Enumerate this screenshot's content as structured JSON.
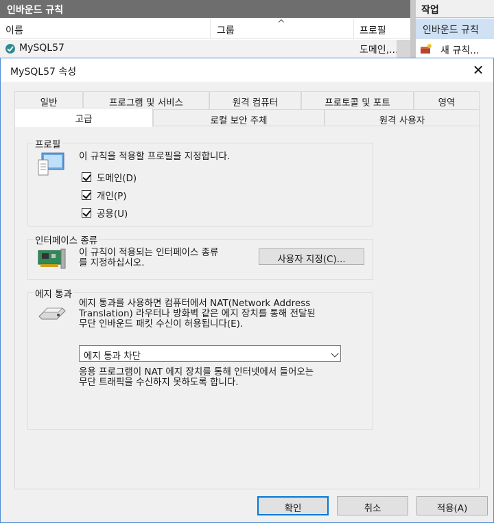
{
  "console": {
    "header": "인바운드 규칙",
    "actions_header": "작업",
    "columns": {
      "name": "이름",
      "group": "그룹",
      "profile": "프로필"
    },
    "sort_indicator": "^",
    "row": {
      "name": "MySQL57",
      "profile": "도메인,..."
    },
    "actions": {
      "inbound": "인바운드 규칙",
      "new_rule": "새 규칙..."
    }
  },
  "dialog": {
    "title": "MySQL57 속성",
    "close_glyph": "✕",
    "tabs_row1": [
      "일반",
      "프로그램 및 서비스",
      "원격 컴퓨터",
      "프로토콜 및 포트",
      "영역"
    ],
    "tabs_row2": [
      "고급",
      "로컬 보안 주체",
      "원격 사용자"
    ],
    "selected_tab": "고급",
    "profile": {
      "title": "프로필",
      "description": "이 규칙을 적용할 프로필을 지정합니다.",
      "options": [
        {
          "label": "도메인(D)",
          "checked": true
        },
        {
          "label": "개인(P)",
          "checked": true
        },
        {
          "label": "공용(U)",
          "checked": true
        }
      ]
    },
    "interface": {
      "title": "인터페이스 종류",
      "line1": "이 규칙이 적용되는 인터페이스 종류",
      "line2": "를 지정하십시오.",
      "button": "사용자 지정(C)..."
    },
    "edge": {
      "title": "에지 통과",
      "line1": "에지 통과를 사용하면 컴퓨터에서 NAT(Network Address",
      "line2": "Translation) 라우터나 방화벽 같은 에지 장치를 통해 전달된",
      "line3": "무단 인바운드 패킷 수신이 허용됩니다(E).",
      "selected": "에지 통과 차단",
      "hint1": "응용 프로그램이 NAT 에지 장치를 통해 인터넷에서 들어오는",
      "hint2": "무단 트래픽을 수신하지 못하도록 합니다."
    },
    "buttons": {
      "ok": "확인",
      "cancel": "취소",
      "apply": "적용(A)"
    }
  },
  "colors": {
    "accent": "#0078d7",
    "header_bg": "#6e6e6e",
    "action_sel": "#cfe1f3"
  }
}
